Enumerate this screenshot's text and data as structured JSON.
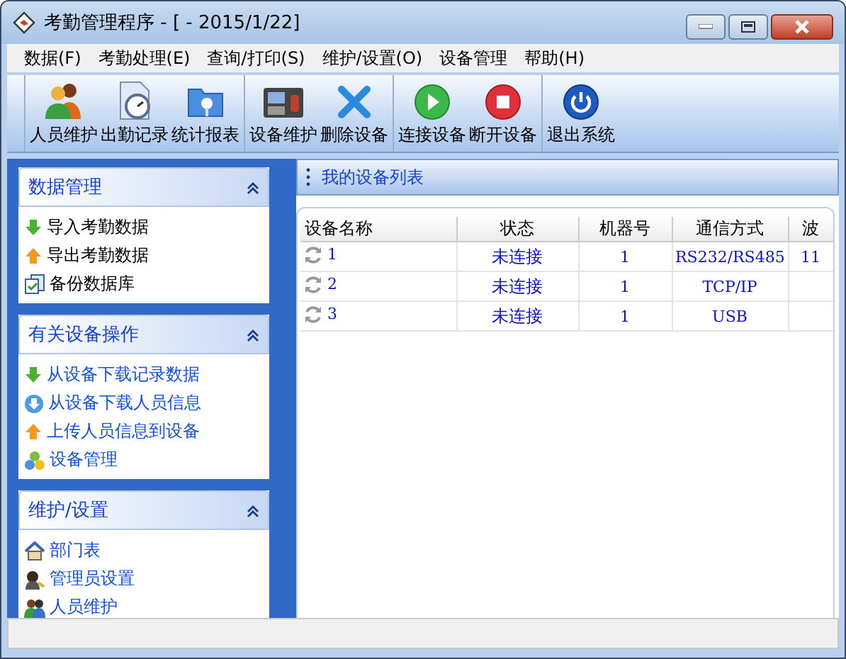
{
  "window": {
    "title": "考勤管理程序 - [ - 2015/1/22]"
  },
  "menu": [
    "数据(F)",
    "考勤处理(E)",
    "查询/打印(S)",
    "维护/设置(O)",
    "设备管理",
    "帮助(H)"
  ],
  "toolbar": [
    [
      "人员维护",
      "出勤记录",
      "统计报表"
    ],
    [
      "设备维护",
      "删除设备"
    ],
    [
      "连接设备",
      "断开设备"
    ],
    [
      "退出系统"
    ]
  ],
  "sidebar": [
    {
      "title": "数据管理",
      "expanded": true,
      "items": [
        "导入考勤数据",
        "导出考勤数据",
        "备份数据库"
      ]
    },
    {
      "title": "有关设备操作",
      "expanded": true,
      "items": [
        "从设备下载记录数据",
        "从设备下载人员信息",
        "上传人员信息到设备",
        "设备管理"
      ]
    },
    {
      "title": "维护/设置",
      "expanded": true,
      "items": [
        "部门表",
        "管理员设置",
        "人员维护"
      ]
    }
  ],
  "device_panel": {
    "title": "我的设备列表"
  },
  "table": {
    "columns": [
      "设备名称",
      "状态",
      "机器号",
      "通信方式",
      "波"
    ],
    "rows": [
      [
        "1",
        "未连接",
        "1",
        "RS232/RS485",
        "11"
      ],
      [
        "2",
        "未连接",
        "1",
        "TCP/IP",
        ""
      ],
      [
        "3",
        "未连接",
        "1",
        "USB",
        ""
      ]
    ]
  }
}
